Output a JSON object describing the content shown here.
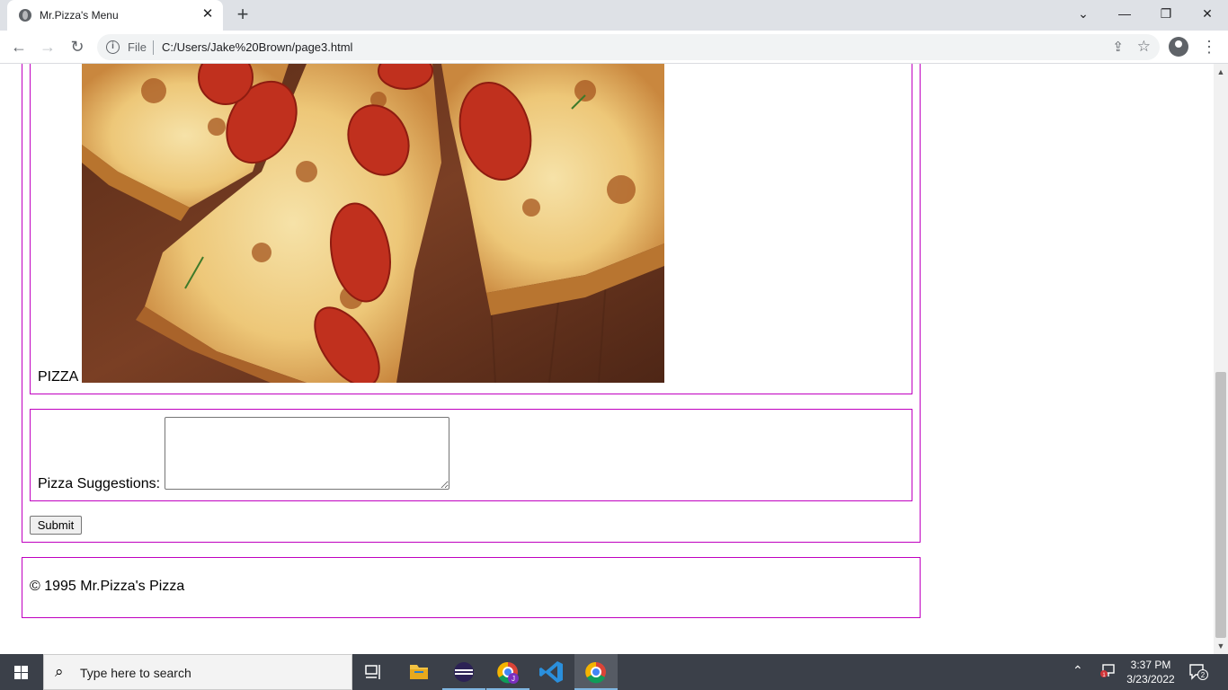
{
  "browser": {
    "tab_title": "Mr.Pizza's Menu",
    "tab_close": "✕",
    "new_tab": "+",
    "scheme_label": "File",
    "url": "C:/Users/Jake%20Brown/page3.html",
    "window_controls": {
      "dropdown": "⌄",
      "minimize": "—",
      "restore": "❐",
      "close": "✕"
    }
  },
  "page": {
    "pizza_label": "PIZZA",
    "suggestions_label": "Pizza Suggestions:",
    "suggestions_value": "",
    "submit_label": "Submit",
    "footer": "© 1995 Mr.Pizza's Pizza",
    "border_color": "#c000c0"
  },
  "taskbar": {
    "search_placeholder": "Type here to search",
    "time": "3:37 PM",
    "date": "3/23/2022",
    "notification_count": "2",
    "apps": [
      "task-view-icon",
      "file-explorer-icon",
      "eclipse-icon",
      "chrome-profile-icon",
      "vscode-icon",
      "chrome-icon"
    ]
  }
}
